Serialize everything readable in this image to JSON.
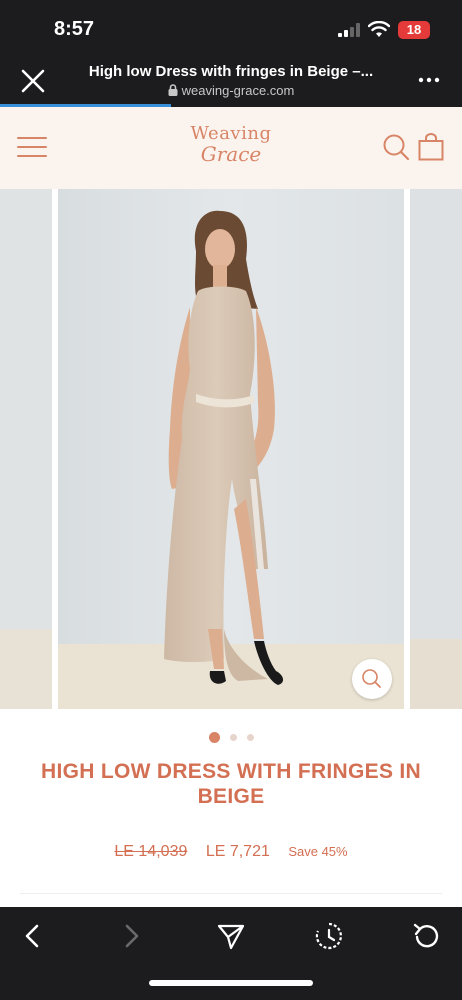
{
  "status": {
    "time": "8:57",
    "battery": "18"
  },
  "browser": {
    "page_title": "High low Dress with fringes in Beige –...",
    "url": "weaving-grace.com",
    "load_progress": 0.37
  },
  "site": {
    "logo_line1": "Weaving",
    "logo_line2": "Grace"
  },
  "product": {
    "title": "HIGH LOW DRESS WITH FRINGES IN BEIGE",
    "old_price": "LE 14,039",
    "new_price": "LE 7,721",
    "save_label": "Save 45%",
    "gallery_count": 3,
    "gallery_active": 0
  },
  "colors": {
    "accent": "#d88466",
    "title": "#d36f52",
    "header_bg": "#fbf4ee",
    "progress": "#3a90d8",
    "battery": "#e53a3a"
  },
  "icons": [
    "close-icon",
    "more-icon",
    "lock-icon",
    "menu-icon",
    "search-icon",
    "bag-icon",
    "zoom-icon",
    "back-icon",
    "forward-icon",
    "share-icon",
    "history-icon",
    "reload-icon"
  ]
}
